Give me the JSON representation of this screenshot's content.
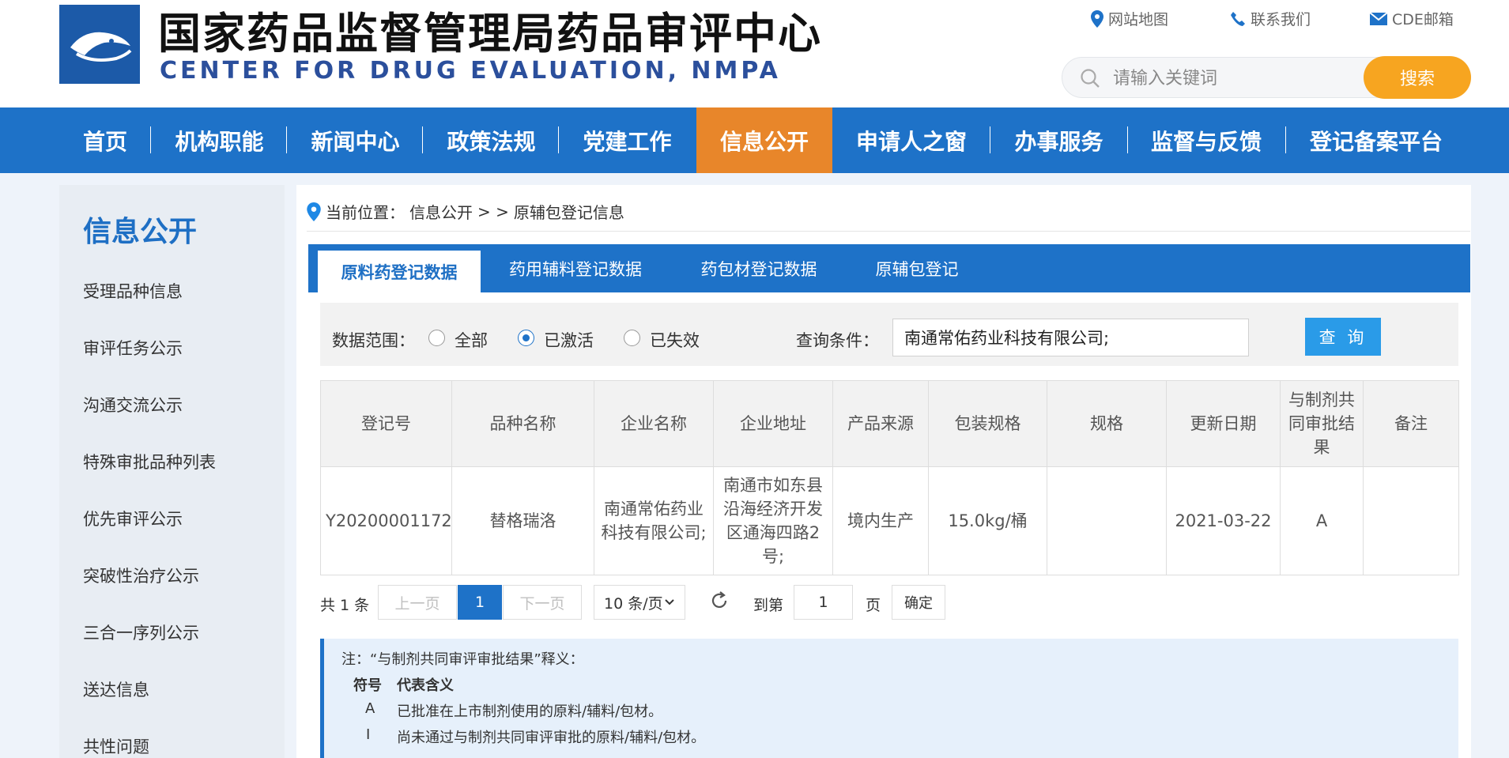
{
  "header": {
    "title": "国家药品监督管理局药品审评中心",
    "subtitle": "CENTER FOR DRUG EVALUATION, NMPA",
    "links": [
      {
        "label": "网站地图",
        "icon": "location-pin-icon"
      },
      {
        "label": "联系我们",
        "icon": "phone-icon"
      },
      {
        "label": "CDE邮箱",
        "icon": "mail-icon"
      }
    ],
    "search": {
      "placeholder": "请输入关键词",
      "button": "搜索"
    }
  },
  "nav": {
    "items": [
      "首页",
      "机构职能",
      "新闻中心",
      "政策法规",
      "党建工作",
      "信息公开",
      "申请人之窗",
      "办事服务",
      "监督与反馈",
      "登记备案平台"
    ],
    "active": "信息公开"
  },
  "sidebar": {
    "title": "信息公开",
    "items": [
      "受理品种信息",
      "审评任务公示",
      "沟通交流公示",
      "特殊审批品种列表",
      "优先审评公示",
      "突破性治疗公示",
      "三合一序列公示",
      "送达信息",
      "共性问题"
    ]
  },
  "breadcrumb": {
    "label": "当前位置：",
    "path1": "信息公开",
    "sep": "> >",
    "path2": "原辅包登记信息"
  },
  "tabs": [
    "原料药登记数据",
    "药用辅料登记数据",
    "药包材登记数据",
    "原辅包登记"
  ],
  "filter": {
    "range_label": "数据范围：",
    "options": [
      "全部",
      "已激活",
      "已失效"
    ],
    "selected": "已激活",
    "query_label": "查询条件：",
    "query_value": "南通常佑药业科技有限公司;",
    "query_button": "查 询"
  },
  "table": {
    "headers": [
      "登记号",
      "品种名称",
      "企业名称",
      "企业地址",
      "产品来源",
      "包装规格",
      "规格",
      "更新日期",
      "与制剂共同审批结果",
      "备注"
    ],
    "rows": [
      [
        "Y20200001172",
        "替格瑞洛",
        "南通常佑药业科技有限公司;",
        "南通市如东县沿海经济开发区通海四路2号;",
        "境内生产",
        "15.0kg/桶",
        "",
        "2021-03-22",
        "A",
        ""
      ]
    ]
  },
  "pager": {
    "total": "共 1 条",
    "prev": "上一页",
    "current": "1",
    "next": "下一页",
    "page_size": "10 条/页",
    "goto_label": "到第",
    "goto_value": "1",
    "page_unit": "页",
    "confirm": "确定"
  },
  "note": {
    "title": "注：“与制剂共同审评审批结果”释义：",
    "col_symbol": "符号",
    "col_meaning": "代表含义",
    "items": [
      {
        "symbol": "A",
        "meaning": "已批准在上市制剂使用的原料/辅料/包材。"
      },
      {
        "symbol": "I",
        "meaning": "尚未通过与制剂共同审评审批的原料/辅料/包材。"
      }
    ]
  },
  "colors": {
    "nav_blue": "#1e72c8",
    "active_orange": "#e8862a",
    "search_orange": "#f7a520",
    "query_blue": "#2a9be8"
  }
}
